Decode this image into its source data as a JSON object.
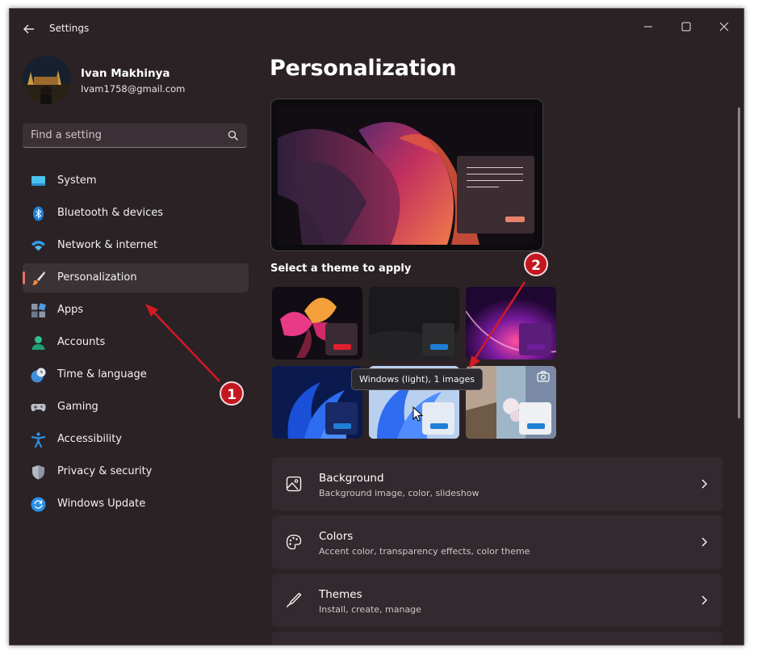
{
  "window": {
    "title": "Settings"
  },
  "profile": {
    "name": "Ivan Makhinya",
    "email": "Ivam1758@gmail.com"
  },
  "search": {
    "placeholder": "Find a setting"
  },
  "nav": {
    "items": [
      {
        "label": "System",
        "icon": "system-icon"
      },
      {
        "label": "Bluetooth & devices",
        "icon": "bluetooth-icon"
      },
      {
        "label": "Network & internet",
        "icon": "wifi-icon"
      },
      {
        "label": "Personalization",
        "icon": "brush-icon",
        "active": true
      },
      {
        "label": "Apps",
        "icon": "apps-icon"
      },
      {
        "label": "Accounts",
        "icon": "account-icon"
      },
      {
        "label": "Time & language",
        "icon": "clock-globe-icon"
      },
      {
        "label": "Gaming",
        "icon": "gamepad-icon"
      },
      {
        "label": "Accessibility",
        "icon": "accessibility-icon"
      },
      {
        "label": "Privacy & security",
        "icon": "shield-icon"
      },
      {
        "label": "Windows Update",
        "icon": "update-icon"
      }
    ]
  },
  "main": {
    "title": "Personalization",
    "theme_section_label": "Select a theme to apply",
    "tooltip": "Windows (light), 1 images",
    "cards": [
      {
        "title": "Background",
        "subtitle": "Background image, color, slideshow",
        "icon": "image-icon"
      },
      {
        "title": "Colors",
        "subtitle": "Accent color, transparency effects, color theme",
        "icon": "palette-icon"
      },
      {
        "title": "Themes",
        "subtitle": "Install, create, manage",
        "icon": "pen-icon"
      }
    ]
  },
  "annotations": {
    "marker_1": "1",
    "marker_2": "2"
  },
  "colors": {
    "window_bg": "#2b2226",
    "accent": "#e87060",
    "annotation_red": "#c3171f"
  }
}
